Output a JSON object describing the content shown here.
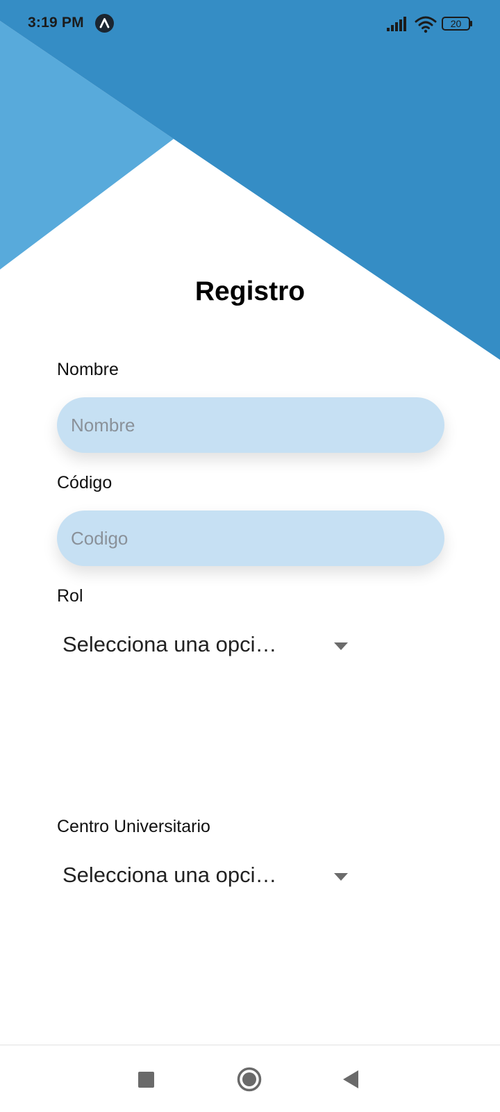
{
  "status_bar": {
    "time": "3:19 PM",
    "battery_level": "20",
    "icons": [
      "app-indicator-icon",
      "signal-icon",
      "wifi-icon",
      "battery-icon"
    ]
  },
  "theme": {
    "primary_blue": "#358dc5",
    "light_blue": "#58aadb",
    "input_fill": "#c6e0f3"
  },
  "form": {
    "title": "Registro",
    "nombre": {
      "label": "Nombre",
      "placeholder": "Nombre",
      "value": ""
    },
    "codigo": {
      "label": "Código",
      "placeholder": "Codigo",
      "value": ""
    },
    "rol": {
      "label": "Rol",
      "selected": "Selecciona una opci…"
    },
    "centro": {
      "label": "Centro Universitario",
      "selected": "Selecciona una opci…"
    }
  },
  "nav_bar": {
    "icons": [
      "recent-apps-icon",
      "home-icon",
      "back-icon"
    ]
  }
}
